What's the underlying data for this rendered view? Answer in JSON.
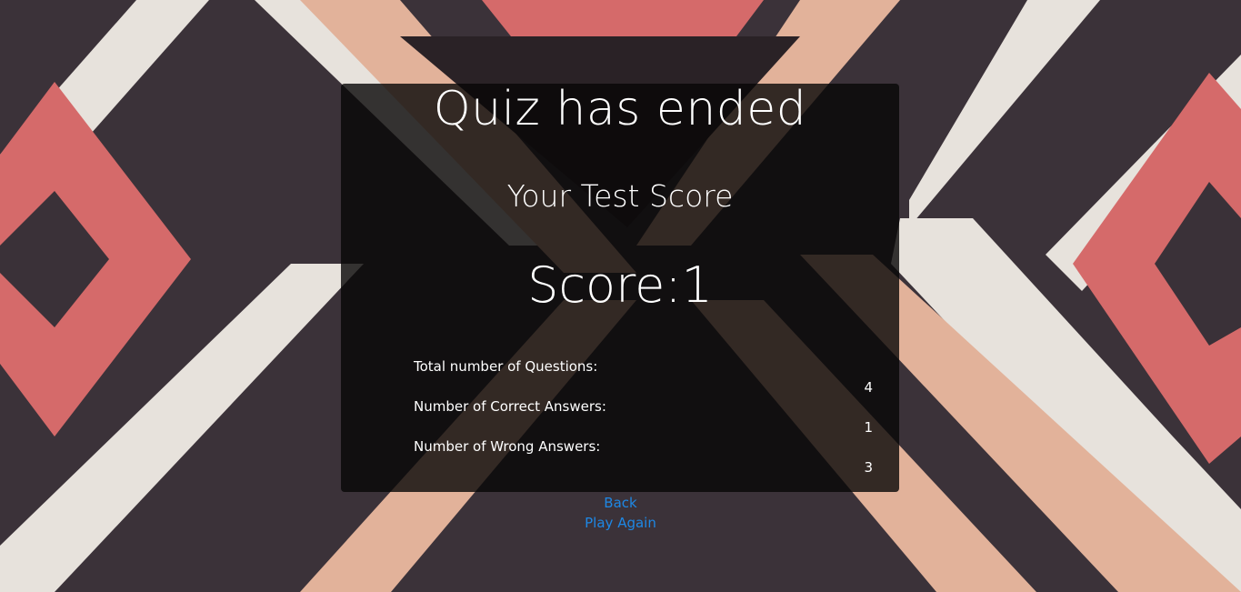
{
  "quiz_end": {
    "title": "Quiz has ended",
    "subtitle": "Your Test Score",
    "score_text": "Score:1"
  },
  "stats": [
    {
      "label": "Total number of Questions:",
      "value": "4"
    },
    {
      "label": "Number of Correct Answers:",
      "value": "1"
    },
    {
      "label": "Number of Wrong Answers:",
      "value": "3"
    }
  ],
  "actions": {
    "back_label": "Back",
    "play_again_label": "Play Again"
  },
  "colors": {
    "link": "#1e88e5",
    "panel_bg": "rgba(8,6,6,0.80)",
    "text": "#ffffff"
  }
}
